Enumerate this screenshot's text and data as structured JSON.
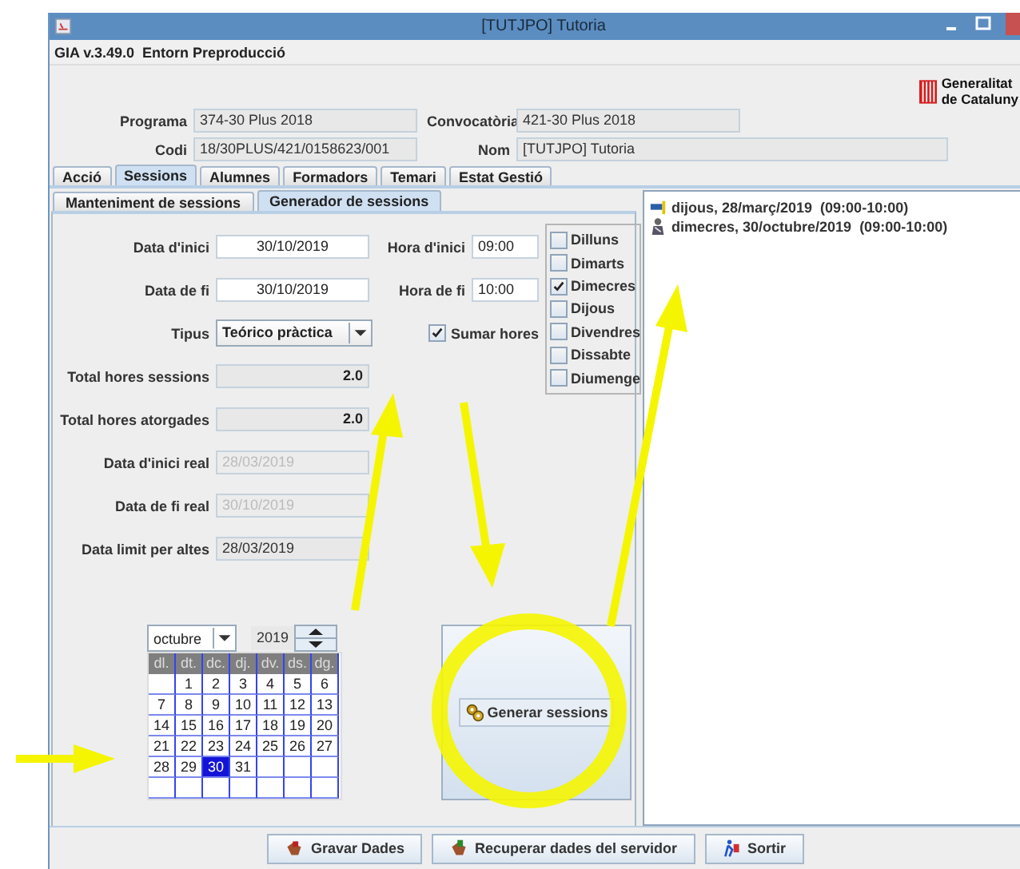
{
  "window": {
    "title": "[TUTJPO] Tutoria"
  },
  "app_bar": {
    "text": "GIA v.3.49.0  Entorn Preproducció"
  },
  "logo": {
    "lines": [
      "Generalitat",
      "de Cataluny"
    ]
  },
  "header_fields": [
    {
      "label": "Programa",
      "value": "374-30 Plus 2018"
    },
    {
      "label": "Convocatòria",
      "value": "421-30 Plus 2018"
    },
    {
      "label": "Codi",
      "value": "18/30PLUS/421/0158623/001"
    },
    {
      "label": "Nom",
      "value": "[TUTJPO] Tutoria"
    }
  ],
  "tabs": [
    {
      "label": "Acció",
      "selected": false
    },
    {
      "label": "Sessions",
      "selected": true
    },
    {
      "label": "Alumnes",
      "selected": false
    },
    {
      "label": "Formadors",
      "selected": false
    },
    {
      "label": "Temari",
      "selected": false
    },
    {
      "label": "Estat Gestió",
      "selected": false
    }
  ],
  "subtabs": [
    {
      "label": "Manteniment de sessions",
      "selected": false
    },
    {
      "label": "Generador de sessions",
      "selected": true
    }
  ],
  "form": {
    "rows": [
      {
        "label": "Data d'inici",
        "kind": "date",
        "value": "30/10/2019"
      },
      {
        "label": "Data de fi",
        "kind": "date",
        "value": "30/10/2019"
      },
      {
        "label": "Tipus",
        "kind": "combo",
        "value": "Teórico pràctica"
      },
      {
        "label": "Total hores sessions",
        "kind": "total",
        "value": "2.0"
      },
      {
        "label": "Total hores atorgades",
        "kind": "total",
        "value": "2.0"
      },
      {
        "label": "Data d'inici real",
        "kind": "disabled",
        "value": "28/03/2019"
      },
      {
        "label": "Data de fi real",
        "kind": "disabled",
        "value": "30/10/2019"
      },
      {
        "label": "Data limit per altes",
        "kind": "readonly",
        "value": "28/03/2019"
      }
    ],
    "time_fields": [
      {
        "label": "Hora d'inici",
        "value": "09:00"
      },
      {
        "label": "Hora de fi",
        "value": "10:00"
      }
    ],
    "sumar_hores": {
      "label": "Sumar hores",
      "checked": true
    }
  },
  "days": [
    {
      "label": "Dilluns",
      "checked": false
    },
    {
      "label": "Dimarts",
      "checked": false
    },
    {
      "label": "Dimecres",
      "checked": true
    },
    {
      "label": "Dijous",
      "checked": false
    },
    {
      "label": "Divendres",
      "checked": false
    },
    {
      "label": "Dissabte",
      "checked": false
    },
    {
      "label": "Diumenge",
      "checked": false
    }
  ],
  "calendar": {
    "month": "octubre",
    "year": "2019",
    "weekdays": [
      "dl.",
      "dt.",
      "dc.",
      "dj.",
      "dv.",
      "ds.",
      "dg."
    ],
    "weeks": [
      [
        {
          "day": "1",
          "selected": false
        },
        {
          "day": "2",
          "selected": false
        },
        {
          "day": "3",
          "selected": false
        },
        {
          "day": "4",
          "selected": false
        },
        {
          "day": "5",
          "selected": false
        },
        {
          "day": "6",
          "selected": false
        }
      ],
      [
        {
          "day": "7",
          "selected": false
        },
        {
          "day": "8",
          "selected": false
        },
        {
          "day": "9",
          "selected": false
        },
        {
          "day": "10",
          "selected": false
        },
        {
          "day": "11",
          "selected": false
        },
        {
          "day": "12",
          "selected": false
        },
        {
          "day": "13",
          "selected": false
        }
      ],
      [
        {
          "day": "14",
          "selected": false
        },
        {
          "day": "15",
          "selected": false
        },
        {
          "day": "16",
          "selected": false
        },
        {
          "day": "17",
          "selected": false
        },
        {
          "day": "18",
          "selected": false
        },
        {
          "day": "19",
          "selected": false
        },
        {
          "day": "20",
          "selected": false
        }
      ],
      [
        {
          "day": "21",
          "selected": false
        },
        {
          "day": "22",
          "selected": false
        },
        {
          "day": "23",
          "selected": false
        },
        {
          "day": "24",
          "selected": false
        },
        {
          "day": "25",
          "selected": false
        },
        {
          "day": "26",
          "selected": false
        },
        {
          "day": "27",
          "selected": false
        }
      ],
      [
        {
          "day": "28",
          "selected": false
        },
        {
          "day": "29",
          "selected": false
        },
        {
          "day": "30",
          "selected": true
        },
        {
          "day": "31",
          "selected": false
        }
      ]
    ]
  },
  "generate_button": {
    "label": "Generar sessions"
  },
  "sessions": [
    {
      "text": "dijous, 28/març/2019  (09:00-10:00)",
      "kind": "flag"
    },
    {
      "text": "dimecres, 30/octubre/2019  (09:00-10:00)",
      "kind": "person"
    }
  ],
  "buttons": [
    {
      "label": "Gravar Dades",
      "kind": "save"
    },
    {
      "label": "Recuperar dades del servidor",
      "kind": "download"
    },
    {
      "label": "Sortir",
      "kind": "exit"
    }
  ]
}
